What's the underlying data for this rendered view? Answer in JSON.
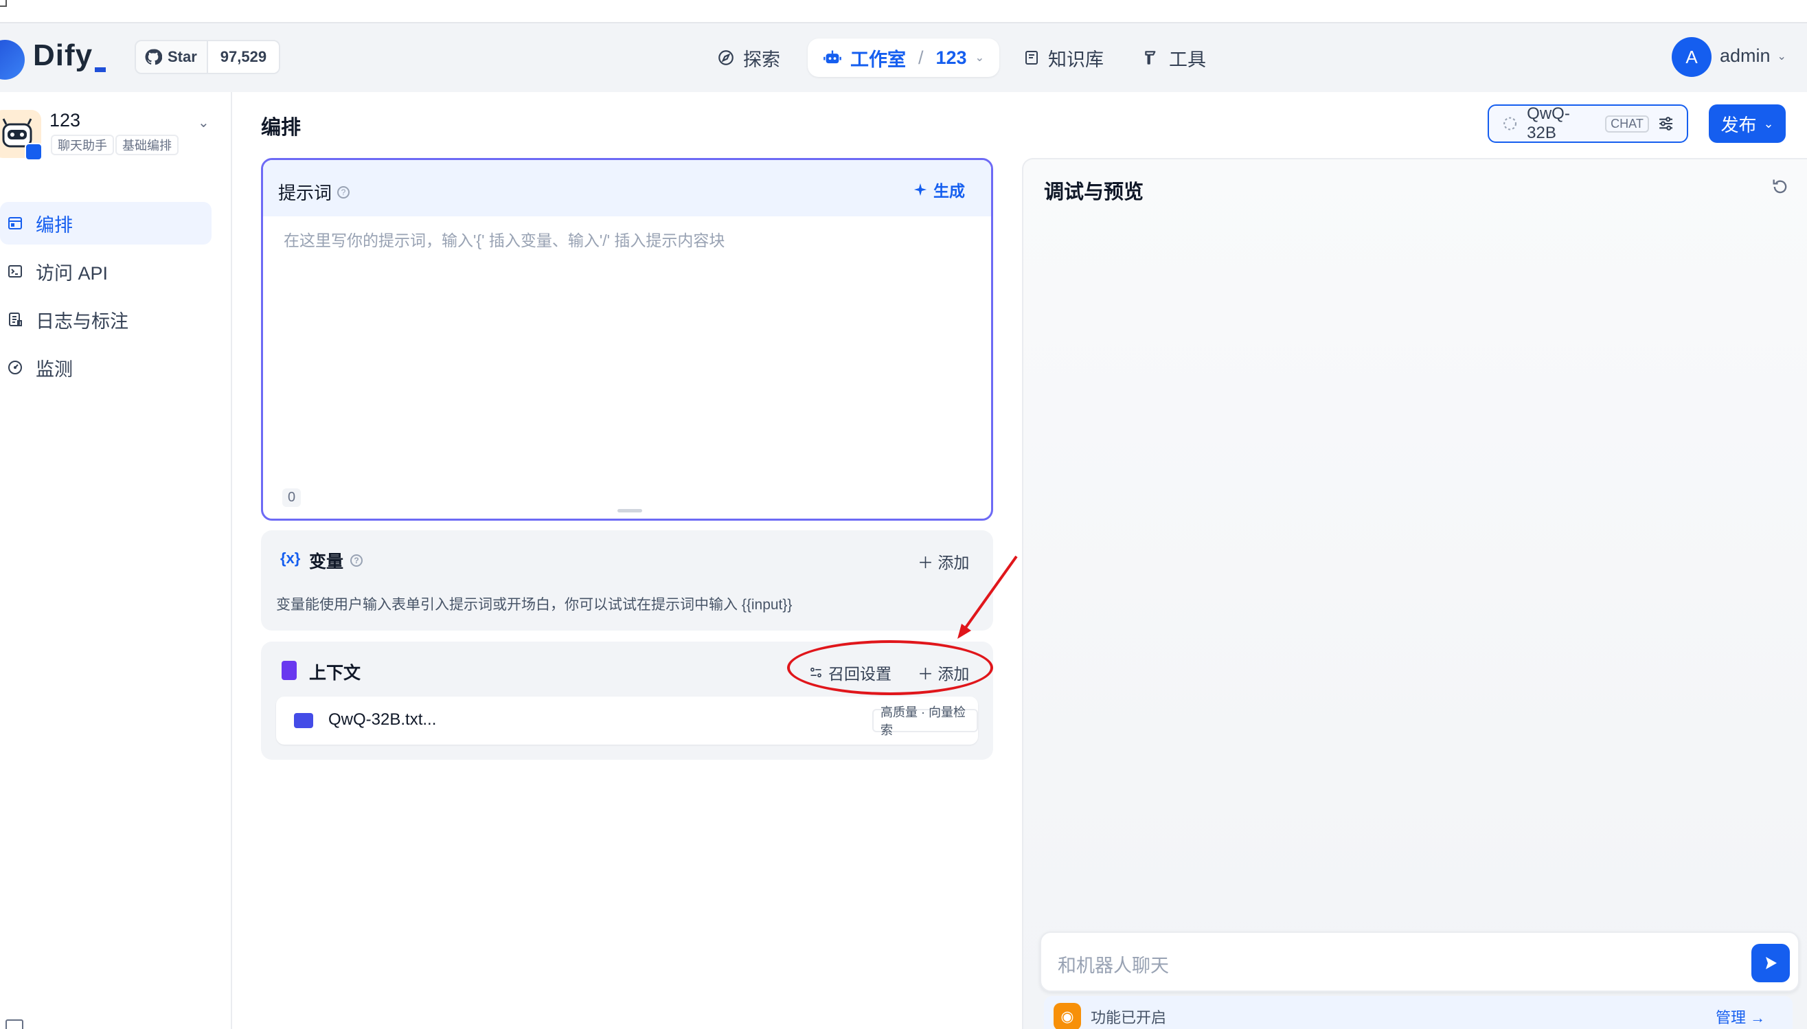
{
  "header": {
    "logo_text": "Dify",
    "github_star_label": "Star",
    "github_star_count": "97,529",
    "nav": {
      "explore": "探索",
      "studio": "工作室",
      "studio_sep": "/",
      "studio_app": "123",
      "knowledge": "知识库",
      "tools": "工具"
    },
    "user_initial": "A",
    "user_name": "admin"
  },
  "sidebar": {
    "app_name": "123",
    "tags": [
      "聊天助手",
      "基础编排"
    ],
    "items": [
      {
        "label": "编排",
        "icon": "layout-icon",
        "active": true
      },
      {
        "label": "访问 API",
        "icon": "terminal-icon",
        "active": false
      },
      {
        "label": "日志与标注",
        "icon": "log-icon",
        "active": false
      },
      {
        "label": "监测",
        "icon": "gauge-icon",
        "active": false
      }
    ]
  },
  "main": {
    "title": "编排",
    "model": {
      "name": "QwQ-32B",
      "mode": "CHAT"
    },
    "publish_label": "发布",
    "prompt": {
      "title": "提示词",
      "generate_label": "生成",
      "placeholder": "在这里写你的提示词，输入'{' 插入变量、输入'/' 插入提示内容块",
      "char_count": "0"
    },
    "variables": {
      "icon_text": "{x}",
      "title": "变量",
      "add_label": "添加",
      "description": "变量能使用户输入表单引入提示词或开场白，你可以试试在提示词中输入 {{input}}"
    },
    "context": {
      "title": "上下文",
      "recall_label": "召回设置",
      "add_label": "添加",
      "item": {
        "name": "QwQ-32B.txt...",
        "badge": "高质量 · 向量检索"
      }
    }
  },
  "debug": {
    "title": "调试与预览",
    "chat_placeholder": "和机器人聊天",
    "feature_text": "功能已开启",
    "manage_label": "管理 →"
  },
  "colors": {
    "accent": "#155eef",
    "prompt_border": "#6d6af5",
    "annotation_red": "#e0161b"
  }
}
